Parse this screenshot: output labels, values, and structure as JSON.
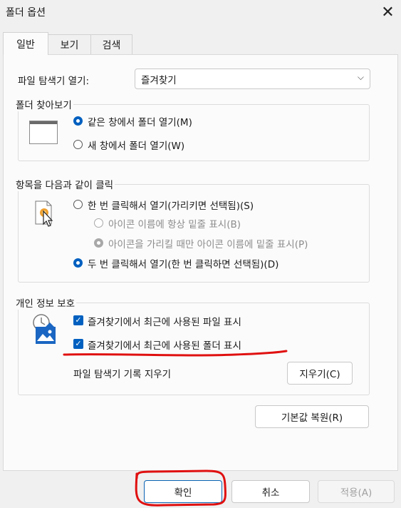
{
  "window": {
    "title": "폴더 옵션",
    "close_glyph": "✕"
  },
  "tabs": [
    {
      "label": "일반"
    },
    {
      "label": "보기"
    },
    {
      "label": "검색"
    }
  ],
  "open_explorer": {
    "label": "파일 탐색기 열기:",
    "selected": "즐겨찾기",
    "arrow_glyph": "⌵"
  },
  "browse_folders": {
    "legend": "폴더 찾아보기",
    "options": [
      {
        "label": "같은 창에서 폴더 열기(M)",
        "checked": true
      },
      {
        "label": "새 창에서 폴더 열기(W)",
        "checked": false
      }
    ]
  },
  "click_items": {
    "legend": "항목을 다음과 같이 클릭",
    "single_click": "한 번 클릭해서 열기(가리키면 선택됨)(S)",
    "underline_always": "아이콘 이름에 항상 밑줄 표시(B)",
    "underline_hover": "아이콘을 가리킬 때만 아이콘 이름에 밑줄 표시(P)",
    "double_click": "두 번 클릭해서 열기(한 번 클릭하면 선택됨)(D)"
  },
  "privacy": {
    "legend": "개인 정보 보호",
    "show_recent_files": "즐겨찾기에서 최근에 사용된 파일 표시",
    "show_recent_folders": "즐겨찾기에서 최근에 사용된 폴더 표시",
    "clear_history_label": "파일 탐색기 기록 지우기",
    "clear_button": "지우기(C)",
    "check_glyph": "✓"
  },
  "restore_defaults": "기본값 복원(R)",
  "footer": {
    "ok": "확인",
    "cancel": "취소",
    "apply": "적용(A)"
  },
  "colors": {
    "accent": "#0060c0",
    "annotation": "#e01010"
  }
}
